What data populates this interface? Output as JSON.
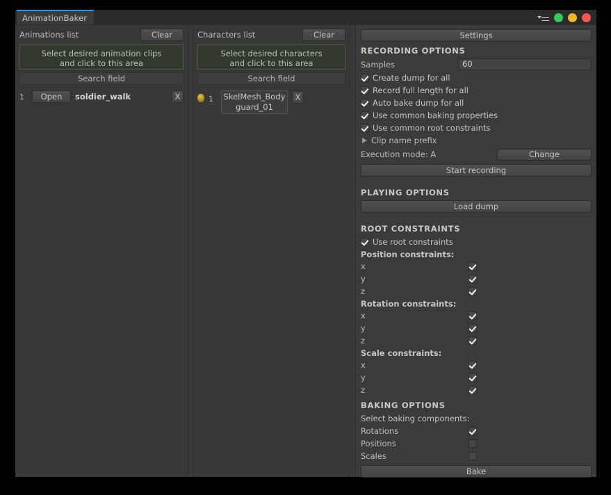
{
  "window": {
    "tab_title": "AnimationBaker",
    "titlebar": {
      "menu_icon": "hamburger-menu-icon",
      "dots": [
        {
          "name": "green-dot",
          "color": "#2ecc5a"
        },
        {
          "name": "yellow-dot",
          "color": "#f0b429"
        },
        {
          "name": "red-dot",
          "color": "#f5554f"
        }
      ]
    }
  },
  "animations_panel": {
    "title": "Animations list",
    "clear_label": "Clear",
    "drop_area_line1": "Select desired animation clips",
    "drop_area_line2": "and click to this area",
    "search_placeholder": "Search field",
    "clips": [
      {
        "index": "1",
        "open_label": "Open",
        "name": "soldier_walk",
        "remove_label": "X"
      }
    ]
  },
  "characters_panel": {
    "title": "Characters list",
    "clear_label": "Clear",
    "drop_area_line1": "Select desired characters",
    "drop_area_line2": "and click to this area",
    "search_placeholder": "Search field",
    "characters": [
      {
        "index": "1",
        "name": "SkelMesh_Bodyguard_01",
        "remove_label": "X",
        "status_icon": "gold-dot-icon"
      }
    ]
  },
  "options_panel": {
    "settings_label": "Settings",
    "recording": {
      "heading": "RECORDING OPTIONS",
      "samples_label": "Samples",
      "samples_value": "60",
      "checkboxes": [
        {
          "label": "Create dump for all",
          "checked": true
        },
        {
          "label": "Record full length for all",
          "checked": true
        },
        {
          "label": "Auto bake dump for all",
          "checked": true
        },
        {
          "label": "Use common baking properties",
          "checked": true
        },
        {
          "label": "Use common root constraints",
          "checked": true
        }
      ],
      "foldout_label": "Clip name prefix",
      "execution_mode_label": "Execution mode: A",
      "change_label": "Change",
      "start_recording_label": "Start recording"
    },
    "playing": {
      "heading": "PLAYING OPTIONS",
      "load_dump_label": "Load dump"
    },
    "root_constraints": {
      "heading": "ROOT CONSTRAINTS",
      "use_root_label": "Use root constraints",
      "use_root_checked": true,
      "groups": [
        {
          "title": "Position constraints:",
          "axes": [
            {
              "label": "x",
              "checked": true
            },
            {
              "label": "y",
              "checked": true
            },
            {
              "label": "z",
              "checked": true
            }
          ]
        },
        {
          "title": "Rotation constraints:",
          "axes": [
            {
              "label": "x",
              "checked": true
            },
            {
              "label": "y",
              "checked": true
            },
            {
              "label": "z",
              "checked": true
            }
          ]
        },
        {
          "title": "Scale constraints:",
          "axes": [
            {
              "label": "x",
              "checked": true
            },
            {
              "label": "y",
              "checked": true
            },
            {
              "label": "z",
              "checked": true
            }
          ]
        }
      ]
    },
    "baking": {
      "heading": "BAKING OPTIONS",
      "select_label": "Select baking components:",
      "components": [
        {
          "label": "Rotations",
          "checked": true
        },
        {
          "label": "Positions",
          "checked": false
        },
        {
          "label": "Scales",
          "checked": false
        }
      ],
      "bake_label": "Bake"
    }
  }
}
